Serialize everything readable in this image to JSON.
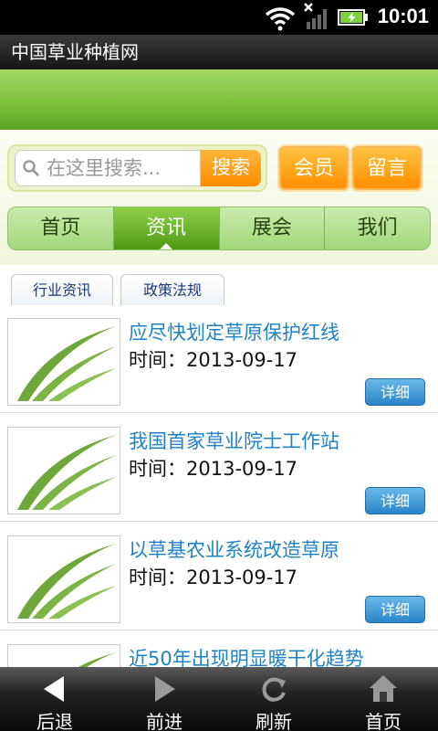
{
  "status_bar": {
    "time": "10:01"
  },
  "title_bar": {
    "title": "中国草业种植网"
  },
  "search": {
    "placeholder": "在这里搜索...",
    "button_label": "搜索"
  },
  "actions": {
    "member_label": "会员",
    "message_label": "留言"
  },
  "nav": {
    "tabs": [
      {
        "label": "首页"
      },
      {
        "label": "资讯",
        "active": true
      },
      {
        "label": "展会"
      },
      {
        "label": "我们"
      }
    ]
  },
  "subtabs": [
    {
      "label": "行业资讯"
    },
    {
      "label": "政策法规"
    }
  ],
  "news": [
    {
      "title": "应尽快划定草原保护红线",
      "time": "时间：2013-09-17",
      "detail_label": "详细"
    },
    {
      "title": "我国首家草业院士工作站",
      "time": "时间：2013-09-17",
      "detail_label": "详细"
    },
    {
      "title": "以草基农业系统改造草原",
      "time": "时间：2013-09-17",
      "detail_label": "详细"
    },
    {
      "title": "近50年出现明显暖干化趋势",
      "time": "",
      "detail_label": ""
    }
  ],
  "bottom_bar": [
    {
      "label": "后退",
      "icon": "back-arrow-icon"
    },
    {
      "label": "前进",
      "icon": "forward-arrow-icon"
    },
    {
      "label": "刷新",
      "icon": "refresh-icon"
    },
    {
      "label": "首页",
      "icon": "home-icon"
    }
  ],
  "colors": {
    "banner_green": "#7cc23a",
    "accent_orange": "#ff8c00",
    "link_blue": "#1e82c3",
    "detail_blue": "#2a86c8"
  }
}
